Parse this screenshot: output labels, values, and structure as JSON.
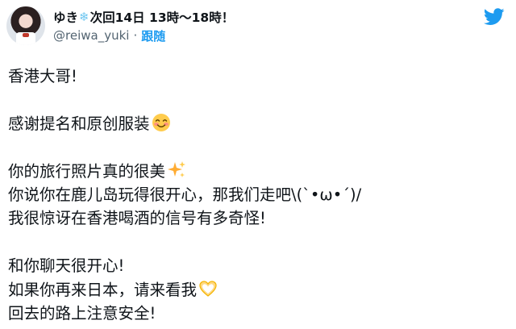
{
  "tweet": {
    "display_name_part1": "ゆき",
    "snow_glyph": "❄",
    "display_name_part2": "次回14日 13時～18時！",
    "handle": "@reiwa_yuki",
    "separator": "·",
    "follow_label": "跟随",
    "brand_color": "#1d9bf0",
    "lines": [
      {
        "text": "香港大哥!"
      },
      {
        "text": ""
      },
      {
        "text": "感谢提名和原创服装",
        "emoji": "smiling-blush-emoji"
      },
      {
        "text": ""
      },
      {
        "text": "你的旅行照片真的很美",
        "emoji": "sparkles-emoji"
      },
      {
        "text": "你说你在鹿儿岛玩得很开心，那我们走吧\\(ˋ•ω•ˊ)/"
      },
      {
        "text": "我很惊讶在香港喝酒的信号有多奇怪!"
      },
      {
        "text": ""
      },
      {
        "text": "和你聊天很开心!"
      },
      {
        "text": "如果你再来日本，请来看我",
        "emoji": "heart-hands-emoji"
      },
      {
        "text": "回去的路上注意安全!"
      }
    ]
  }
}
